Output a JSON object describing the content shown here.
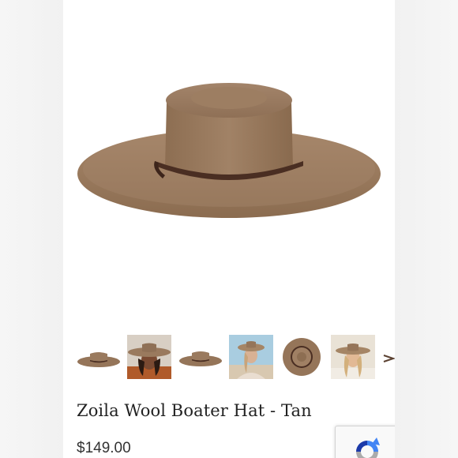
{
  "product": {
    "title": "Zoila Wool Boater Hat - Tan",
    "price": "$149.00",
    "color_tan": "#9a7a5c",
    "band_color": "#4a2e22"
  },
  "gallery": {
    "thumbnails": [
      {
        "name": "thumb-hat-side"
      },
      {
        "name": "thumb-woman-wearing-hat"
      },
      {
        "name": "thumb-hat-side-2"
      },
      {
        "name": "thumb-woman-beach-hat"
      },
      {
        "name": "thumb-hat-top-view"
      },
      {
        "name": "thumb-woman-smiling-hat"
      }
    ],
    "next_icon": "chevron-right-icon"
  },
  "recaptcha": {
    "icon": "recaptcha-logo-icon"
  }
}
